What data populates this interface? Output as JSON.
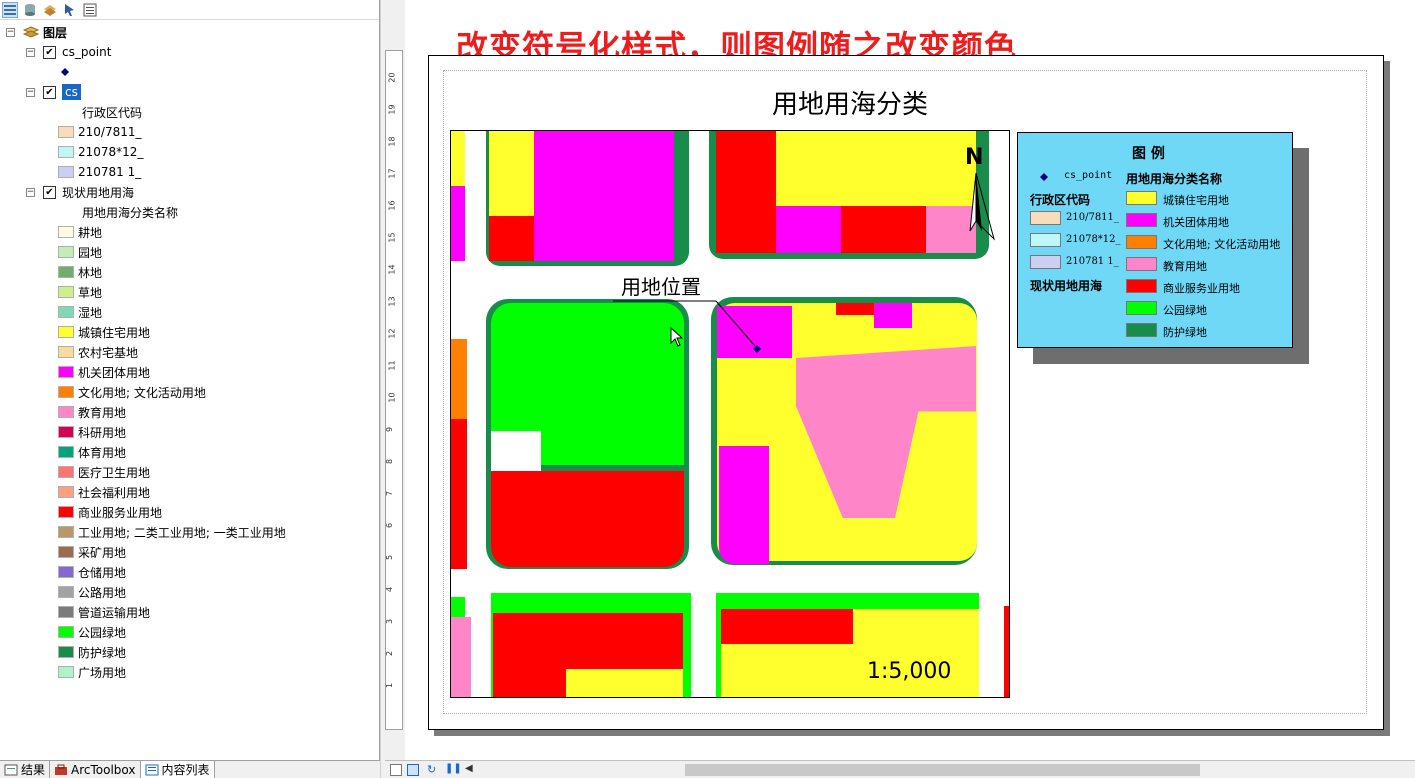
{
  "toc": {
    "root_label": "图层",
    "layers": [
      {
        "name": "cs_point",
        "checked": true
      },
      {
        "name": "cs",
        "checked": true,
        "field": "行政区代码",
        "classes": [
          {
            "label": "210/7811_",
            "color": "#f9dcbc"
          },
          {
            "label": "21078*12_",
            "color": "#bff7f7"
          },
          {
            "label": "210781 1_",
            "color": "#cccff0"
          }
        ]
      },
      {
        "name": "现状用地用海",
        "checked": true,
        "field": "用地用海分类名称",
        "classes": [
          {
            "label": "耕地",
            "color": "#fffbe0"
          },
          {
            "label": "园地",
            "color": "#c3ecb7"
          },
          {
            "label": "林地",
            "color": "#6fae6b"
          },
          {
            "label": "草地",
            "color": "#cef08a"
          },
          {
            "label": "湿地",
            "color": "#7dd9b6"
          },
          {
            "label": "城镇住宅用地",
            "color": "#ffff2d"
          },
          {
            "label": "农村宅基地",
            "color": "#f9dc9b"
          },
          {
            "label": "机关团体用地",
            "color": "#ff00ff"
          },
          {
            "label": "文化用地; 文化活动用地",
            "color": "#ff7f00"
          },
          {
            "label": "教育用地",
            "color": "#ff85c9"
          },
          {
            "label": "科研用地",
            "color": "#d80051"
          },
          {
            "label": "体育用地",
            "color": "#00a57c"
          },
          {
            "label": "医疗卫生用地",
            "color": "#ff7373"
          },
          {
            "label": "社会福利用地",
            "color": "#ff9f7f"
          },
          {
            "label": "商业服务业用地",
            "color": "#ff0000"
          },
          {
            "label": "工业用地; 二类工业用地; 一类工业用地",
            "color": "#bb9668"
          },
          {
            "label": "采矿用地",
            "color": "#9e6b4e"
          },
          {
            "label": "仓储用地",
            "color": "#8767d2"
          },
          {
            "label": "公路用地",
            "color": "#a3a3a3"
          },
          {
            "label": "管道运输用地",
            "color": "#7b7b7b"
          },
          {
            "label": "公园绿地",
            "color": "#00ff00"
          },
          {
            "label": "防护绿地",
            "color": "#178c4b"
          },
          {
            "label": "广场用地",
            "color": "#adf5c9"
          }
        ]
      }
    ]
  },
  "bottom_tabs": [
    "结果",
    "ArcToolbox",
    "内容列表"
  ],
  "annotation": "改变符号化样式，则图例随之改变颜色",
  "map": {
    "title": "用地用海分类",
    "callout": "用地位置",
    "north_label": "N",
    "scale_text": "1:5,000"
  },
  "legend": {
    "title": "图  例",
    "point_label": "cs_point",
    "admin_heading": "行政区代码",
    "admin_items": [
      {
        "label": "210/7811_",
        "color": "#f9dcbc"
      },
      {
        "label": "21078*12_",
        "color": "#bff7f7"
      },
      {
        "label": "210781 1_",
        "color": "#cccff0"
      }
    ],
    "landuse_group_label": "现状用地用海",
    "landuse_heading": "用地用海分类名称",
    "landuse_items": [
      {
        "label": "城镇住宅用地",
        "color": "#ffff2d"
      },
      {
        "label": "机关团体用地",
        "color": "#ff00ff"
      },
      {
        "label": "文化用地; 文化活动用地",
        "color": "#ff7f00"
      },
      {
        "label": "教育用地",
        "color": "#ff85c9"
      },
      {
        "label": "商业服务业用地",
        "color": "#ff0000"
      },
      {
        "label": "公园绿地",
        "color": "#00ff00"
      },
      {
        "label": "防护绿地",
        "color": "#178c4b"
      }
    ]
  },
  "ruler_ticks": [
    "20",
    "19",
    "18",
    "17",
    "16",
    "15",
    "14",
    "13",
    "12",
    "11",
    "10",
    "9",
    "8",
    "7",
    "6",
    "5",
    "4",
    "3",
    "2",
    "1"
  ]
}
